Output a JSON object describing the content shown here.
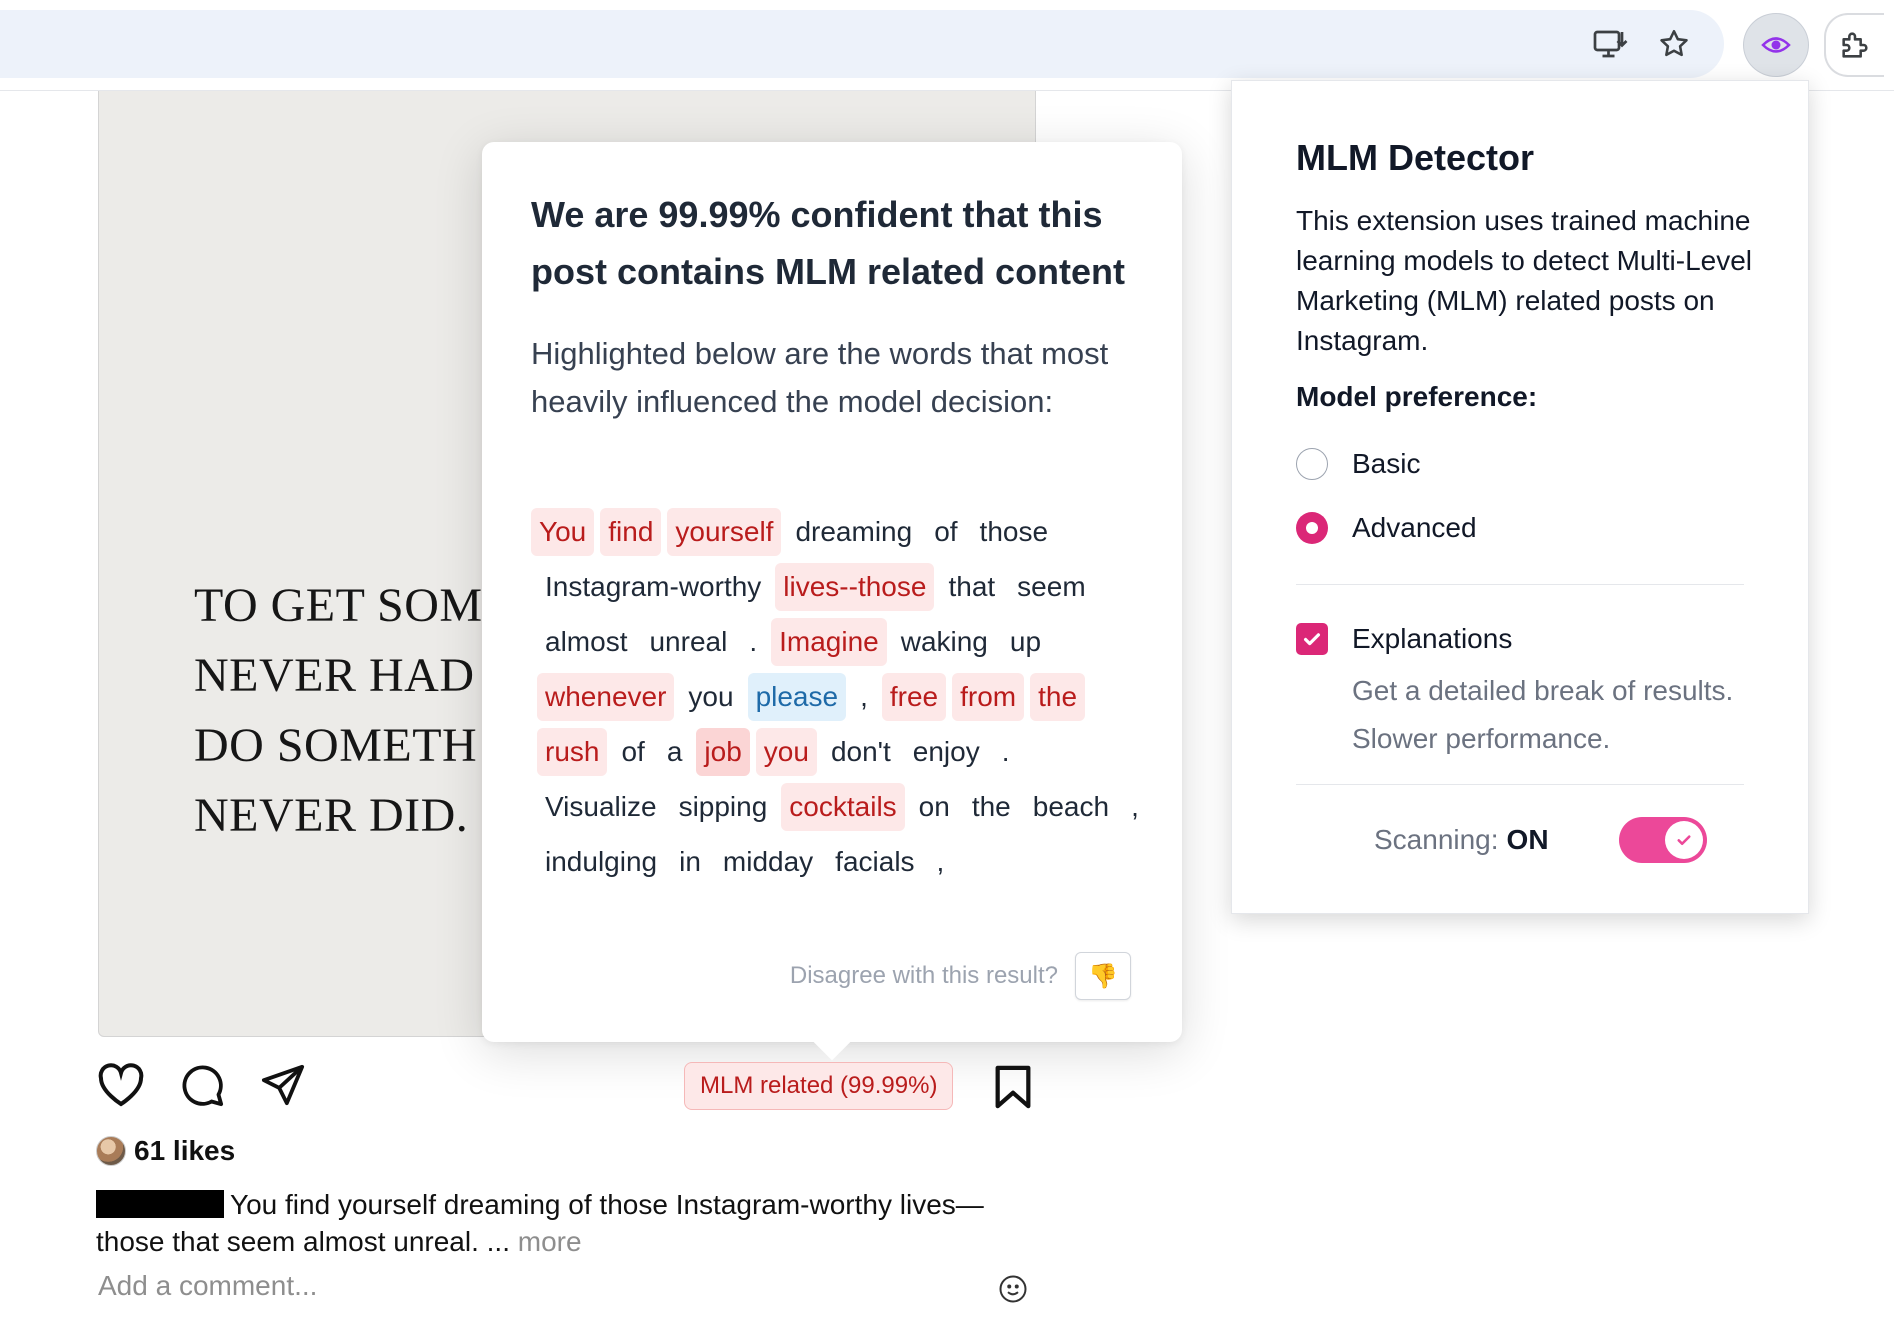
{
  "browser": {
    "install_icon": "install-app-icon",
    "star_icon": "bookmark-star-icon",
    "extension_icon": "eye-icon",
    "extensions_icon": "puzzle-icon"
  },
  "post": {
    "image_quote_lines": [
      "TO GET SOM",
      "NEVER HAD",
      "DO SOMETH",
      "NEVER DID."
    ],
    "likes_count": "61 likes",
    "caption_text": "You find yourself dreaming of those Instagram-worthy lives—those that seem almost unreal. ...",
    "more_label": "more",
    "comment_placeholder": "Add a comment...",
    "badge_label": "MLM related (99.99%)"
  },
  "popup": {
    "title": "We are 99.99% confident that this post contains MLM related content",
    "subtitle": "Highlighted below are the words that most heavily influenced the model decision:",
    "tokens": [
      {
        "text": "You",
        "weight": "pos1"
      },
      {
        "text": "find",
        "weight": "pos1"
      },
      {
        "text": "yourself",
        "weight": "pos1"
      },
      {
        "text": "dreaming",
        "weight": "none"
      },
      {
        "text": "of",
        "weight": "none"
      },
      {
        "text": "those",
        "weight": "none"
      },
      {
        "text": "Instagram-worthy",
        "weight": "none"
      },
      {
        "text": "lives--those",
        "weight": "pos1"
      },
      {
        "text": "that",
        "weight": "none"
      },
      {
        "text": "seem",
        "weight": "none"
      },
      {
        "text": "almost",
        "weight": "none"
      },
      {
        "text": "unreal",
        "weight": "none"
      },
      {
        "text": ".",
        "weight": "none"
      },
      {
        "text": "Imagine",
        "weight": "pos1"
      },
      {
        "text": "waking",
        "weight": "none"
      },
      {
        "text": "up",
        "weight": "none"
      },
      {
        "text": "whenever",
        "weight": "pos1"
      },
      {
        "text": "you",
        "weight": "none"
      },
      {
        "text": "please",
        "weight": "neg"
      },
      {
        "text": ",",
        "weight": "none"
      },
      {
        "text": "free",
        "weight": "pos1"
      },
      {
        "text": "from",
        "weight": "pos1"
      },
      {
        "text": "the",
        "weight": "pos1"
      },
      {
        "text": "rush",
        "weight": "pos1"
      },
      {
        "text": "of",
        "weight": "none"
      },
      {
        "text": "a",
        "weight": "none"
      },
      {
        "text": "job",
        "weight": "pos2"
      },
      {
        "text": "you",
        "weight": "pos1"
      },
      {
        "text": "don't",
        "weight": "none"
      },
      {
        "text": "enjoy",
        "weight": "none"
      },
      {
        "text": ".",
        "weight": "none"
      },
      {
        "text": "Visualize",
        "weight": "none"
      },
      {
        "text": "sipping",
        "weight": "none"
      },
      {
        "text": "cocktails",
        "weight": "pos1"
      },
      {
        "text": "on",
        "weight": "none"
      },
      {
        "text": "the",
        "weight": "none"
      },
      {
        "text": "beach",
        "weight": "none"
      },
      {
        "text": ",",
        "weight": "none"
      },
      {
        "text": "indulging",
        "weight": "none"
      },
      {
        "text": "in",
        "weight": "none"
      },
      {
        "text": "midday",
        "weight": "none"
      },
      {
        "text": "facials",
        "weight": "none"
      },
      {
        "text": ",",
        "weight": "none"
      }
    ],
    "disagree_label": "Disagree with this result?",
    "thumb_icon": "👎"
  },
  "extension": {
    "title": "MLM Detector",
    "description": "This extension uses trained machine learning models to detect Multi-Level Marketing (MLM) related posts on Instagram.",
    "model_pref_label": "Model preference:",
    "options": [
      {
        "label": "Basic",
        "selected": false
      },
      {
        "label": "Advanced",
        "selected": true
      }
    ],
    "explanations_label": "Explanations",
    "explanations_checked": true,
    "explanations_hint": "Get a detailed break of results. Slower performance.",
    "scanning_label": "Scanning:",
    "scanning_state": "ON",
    "accent_color": "#db2777"
  }
}
